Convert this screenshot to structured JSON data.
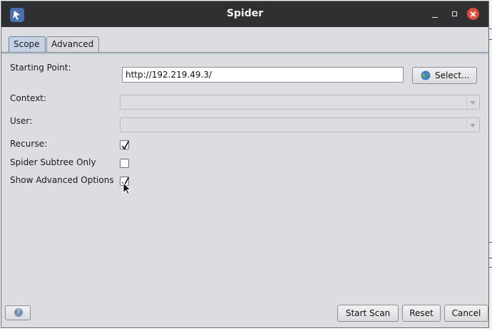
{
  "window": {
    "title": "Spider"
  },
  "titlebar": {
    "app_icon": "spider-app-icon",
    "controls": [
      "minimize-icon",
      "maximize-icon",
      "close-icon"
    ]
  },
  "tabs": [
    {
      "label": "Scope",
      "active": true
    },
    {
      "label": "Advanced",
      "active": false
    }
  ],
  "form": {
    "starting_point": {
      "label": "Starting Point:",
      "value": "http://192.219.49.3/",
      "button": "Select..."
    },
    "context": {
      "label": "Context:",
      "value": ""
    },
    "user": {
      "label": "User:",
      "value": ""
    },
    "recurse": {
      "label": "Recurse:",
      "checked": true
    },
    "subtree_only": {
      "label": "Spider Subtree Only",
      "checked": false
    },
    "show_advanced": {
      "label": "Show Advanced Options",
      "checked": true
    }
  },
  "footer": {
    "help_icon": "help-icon",
    "start_scan": "Start Scan",
    "reset": "Reset",
    "cancel": "Cancel"
  },
  "colors": {
    "titlebar_bg": "#2f3032",
    "dialog_bg": "#dcdde0",
    "close_button": "#e24b3b",
    "active_tab": "#c5d2e3"
  }
}
